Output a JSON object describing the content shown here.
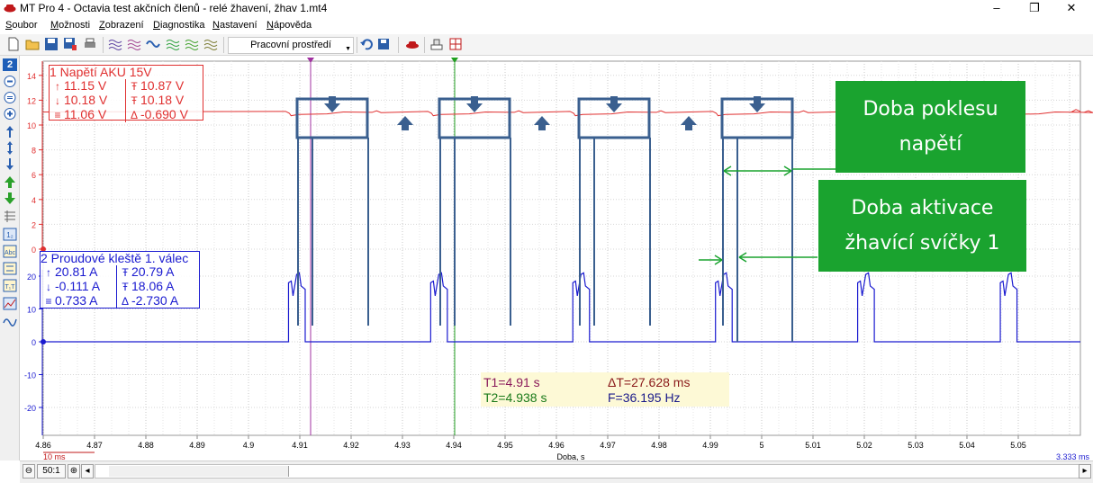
{
  "window": {
    "title": "MT Pro 4 - Octavia test akčních členů - relé žhavení, žhav 1.mt4",
    "minimize_label": "–",
    "maximize_label": "❐",
    "close_label": "✕"
  },
  "menu": [
    "Soubor",
    "Možnosti",
    "Zobrazení",
    "Diagnostika",
    "Nastavení",
    "Nápověda"
  ],
  "toolbar": {
    "workspace_label": "Pracovní prostředí"
  },
  "left_tools": {
    "page_number": "2"
  },
  "channel1": {
    "label": "1 Napětí AKU 15V",
    "max": "11.15 V",
    "min": "10.18 V",
    "avg": "11.06 V",
    "cursor1": "10.87 V",
    "cursor2": "10.18 V",
    "delta": "-0.690 V",
    "color": "#e03030"
  },
  "channel2": {
    "label": "2 Proudové kleště 1. válec",
    "max": "20.81 A",
    "min": "-0.111 A",
    "avg": "0.733 A",
    "cursor1": "20.79 A",
    "cursor2": "18.06 A",
    "delta": "-2.730 A",
    "color": "#1a1ad0"
  },
  "cursors": {
    "t1": "T1=4.91 s",
    "t2": "T2=4.938 s",
    "dt": "ΔT=27.628 ms",
    "f": "F=36.195 Hz"
  },
  "axes": {
    "y1_ticks": [
      "14",
      "12",
      "10",
      "8",
      "6",
      "4",
      "2",
      "0"
    ],
    "y2_ticks": [
      "20",
      "10",
      "0",
      "-10",
      "-20"
    ],
    "x_ticks": [
      "4.86",
      "4.87",
      "4.88",
      "4.89",
      "4.9",
      "4.91",
      "4.92",
      "4.93",
      "4.94",
      "4.95",
      "4.96",
      "4.97",
      "4.98",
      "4.99",
      "5",
      "5.01",
      "5.02",
      "5.03",
      "5.04",
      "5.05"
    ],
    "x_label": "Doba, s",
    "x_division": "10 ms",
    "resolution": "3.333 ms"
  },
  "annotations": {
    "callout_drop": [
      "Doba poklesu",
      "napětí"
    ],
    "callout_activation": [
      "Doba aktivace",
      "žhavící svíčky 1"
    ],
    "callout_color": "#1aa32f",
    "marker_color": "#3a5f8f"
  },
  "statusbar": {
    "zoom": "50:1"
  }
}
